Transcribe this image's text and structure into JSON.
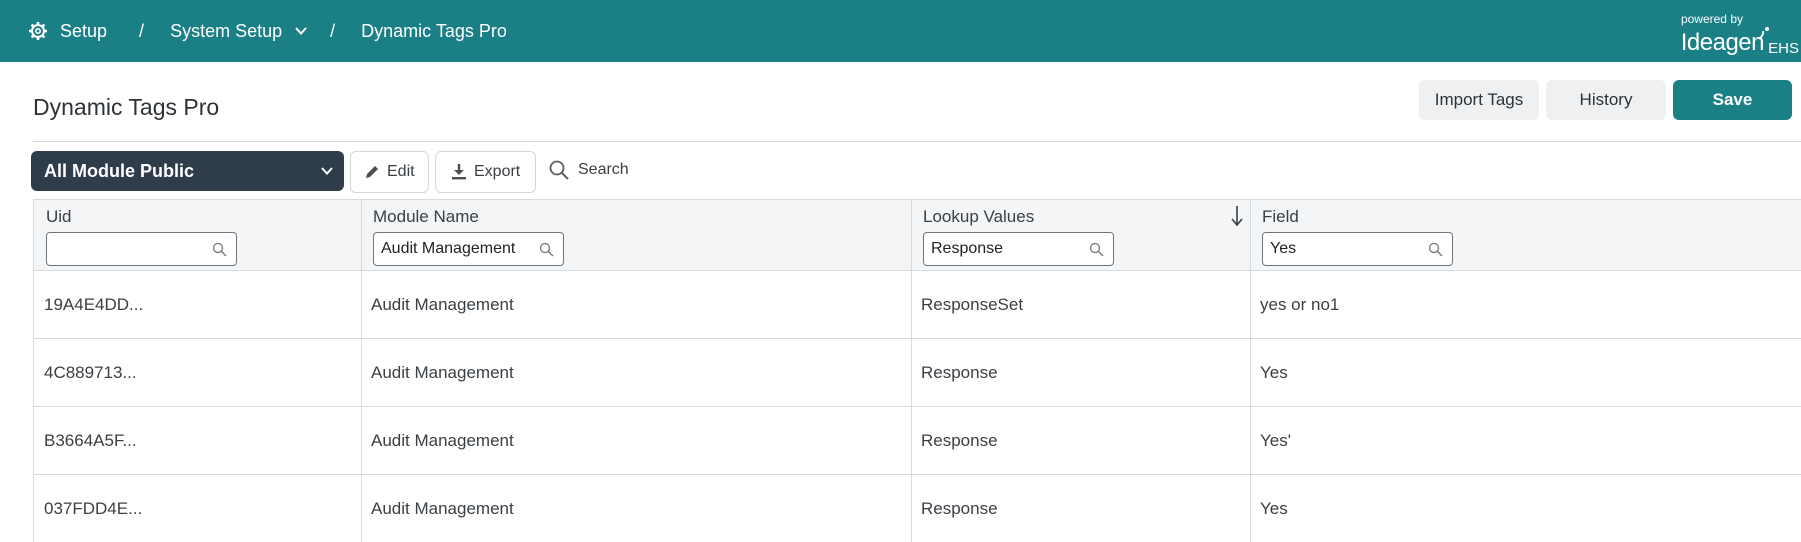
{
  "topbar": {
    "setup_label": "Setup",
    "system_setup_label": "System Setup",
    "current_label": "Dynamic Tags Pro",
    "separator": "/",
    "brand_powered": "powered by",
    "brand_name": "Ideagen",
    "brand_suffix": "EHS",
    "colors": {
      "bar": "#1b7f86"
    }
  },
  "header": {
    "title": "Dynamic Tags Pro",
    "import_label": "Import Tags",
    "history_label": "History",
    "save_label": "Save"
  },
  "toolbar": {
    "module_select_value": "All Module Public",
    "edit_label": "Edit",
    "export_label": "Export",
    "search_label": "Search"
  },
  "table": {
    "columns": [
      {
        "label": "Uid",
        "filter": ""
      },
      {
        "label": "Module Name",
        "filter": "Audit Management"
      },
      {
        "label": "Lookup Values",
        "filter": "Response"
      },
      {
        "label": "Field",
        "filter": "Yes"
      }
    ],
    "rows": [
      [
        "19A4E4DD...",
        "Audit Management",
        "ResponseSet",
        "yes or no1"
      ],
      [
        "4C889713...",
        "Audit Management",
        "Response",
        "Yes"
      ],
      [
        "B3664A5F...",
        "Audit Management",
        "Response",
        "Yes'"
      ],
      [
        "037FDD4E...",
        "Audit Management",
        "Response",
        "Yes"
      ]
    ]
  }
}
